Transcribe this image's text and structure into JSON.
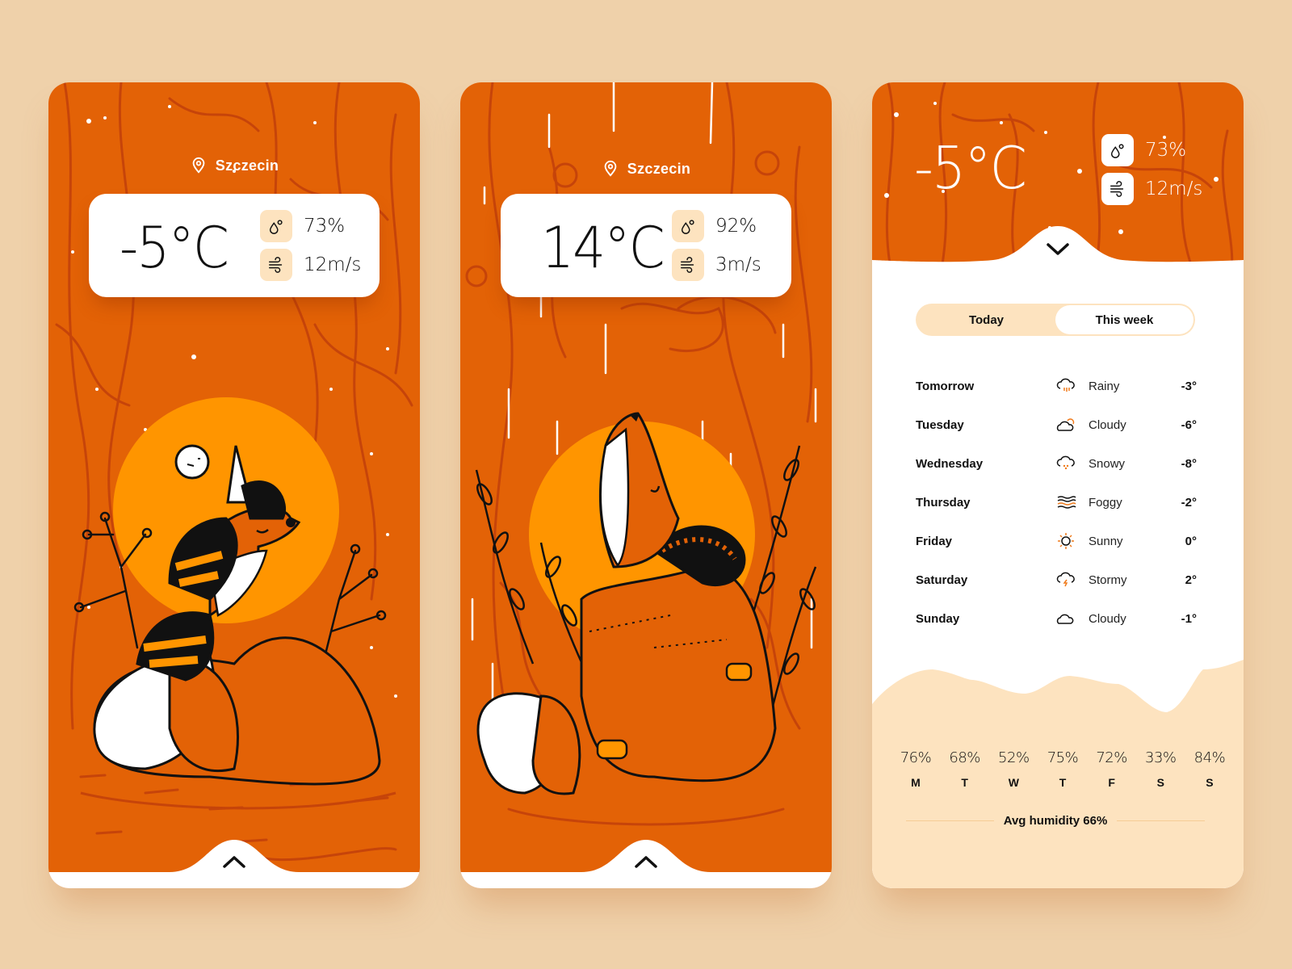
{
  "colors": {
    "page_bg": "#efd1aa",
    "scene_orange": "#e36206",
    "scene_line": "#c6440a",
    "sun": "#ff9500",
    "accent_light": "#fde3bf",
    "icon_accent": "#f07a1a"
  },
  "screens": [
    {
      "location": "Szczecin",
      "location_icon": "map-pin-icon",
      "temperature": "-5°C",
      "humidity": "73%",
      "wind": "12m/s",
      "humidity_icon": "droplets-icon",
      "wind_icon": "wind-icon",
      "pull_icon": "chevron-up-icon",
      "illustration": "fox-with-scarf-snow"
    },
    {
      "location": "Szczecin",
      "location_icon": "map-pin-icon",
      "temperature": "14°C",
      "humidity": "92%",
      "wind": "3m/s",
      "humidity_icon": "droplets-icon",
      "wind_icon": "wind-icon",
      "pull_icon": "chevron-up-icon",
      "illustration": "fox-in-raincoat-rain"
    },
    {
      "temperature": "-5°C",
      "humidity": "73%",
      "wind": "12m/s",
      "collapse_icon": "chevron-down-icon",
      "tabs": [
        {
          "label": "Today",
          "active": true
        },
        {
          "label": "This week",
          "active": false
        }
      ],
      "forecast": [
        {
          "day": "Tomorrow",
          "icon": "rain-cloud-icon",
          "condition": "Rainy",
          "temp": "-3°"
        },
        {
          "day": "Tuesday",
          "icon": "partly-cloudy-icon",
          "condition": "Cloudy",
          "temp": "-6°"
        },
        {
          "day": "Wednesday",
          "icon": "snow-cloud-icon",
          "condition": "Snowy",
          "temp": "-8°"
        },
        {
          "day": "Thursday",
          "icon": "fog-icon",
          "condition": "Foggy",
          "temp": "-2°"
        },
        {
          "day": "Friday",
          "icon": "sun-icon",
          "condition": "Sunny",
          "temp": "0°"
        },
        {
          "day": "Saturday",
          "icon": "storm-cloud-icon",
          "condition": "Stormy",
          "temp": "2°"
        },
        {
          "day": "Sunday",
          "icon": "cloud-icon",
          "condition": "Cloudy",
          "temp": "-1°"
        }
      ],
      "humidity_week": [
        {
          "pct": "76%",
          "day": "M",
          "value": 76
        },
        {
          "pct": "68%",
          "day": "T",
          "value": 68
        },
        {
          "pct": "52%",
          "day": "W",
          "value": 52
        },
        {
          "pct": "75%",
          "day": "T",
          "value": 75
        },
        {
          "pct": "72%",
          "day": "F",
          "value": 72
        },
        {
          "pct": "33%",
          "day": "S",
          "value": 33
        },
        {
          "pct": "84%",
          "day": "S",
          "value": 84
        }
      ],
      "avg_humidity": "Avg humidity 66%"
    }
  ]
}
